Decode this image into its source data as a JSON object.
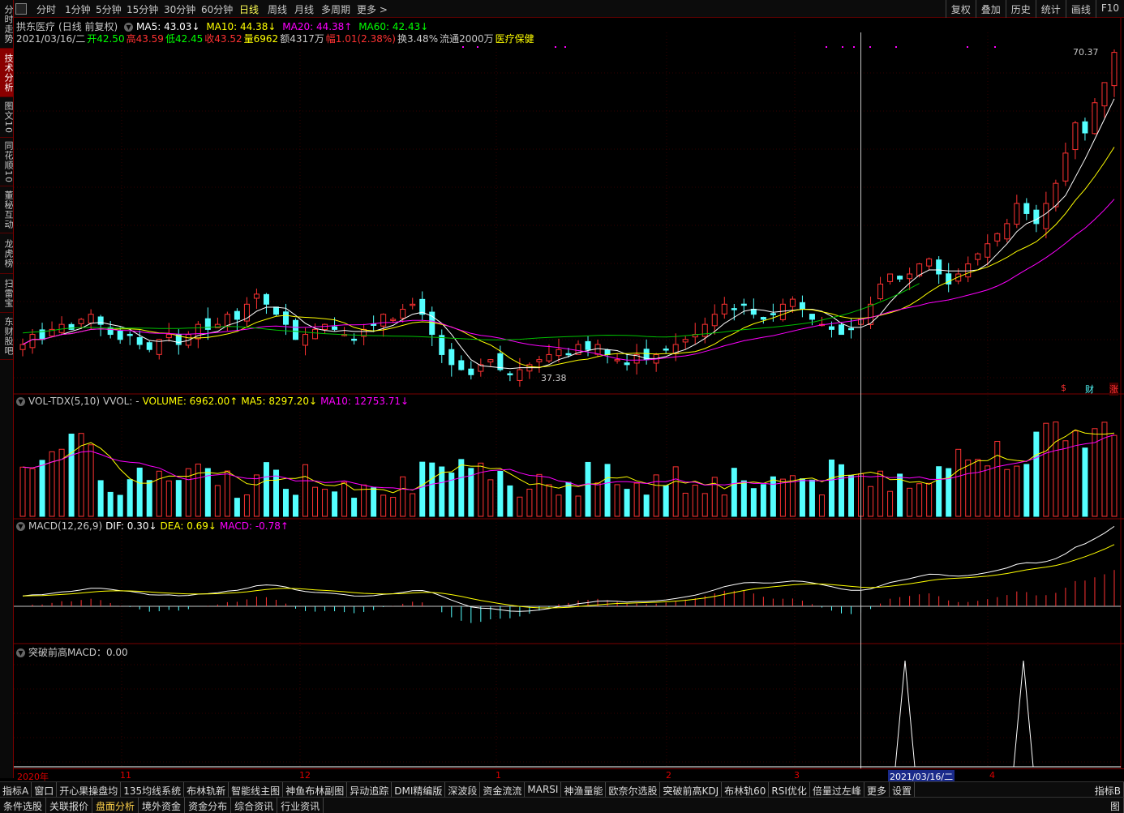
{
  "period_bar": {
    "menu_icon": "menu-icon",
    "items": [
      "分时",
      "1分钟",
      "5分钟",
      "15分钟",
      "30分钟",
      "60分钟",
      "日线",
      "周线",
      "月线",
      "多周期",
      "更多 >"
    ],
    "active": "日线"
  },
  "right_tools": [
    "复权",
    "叠加",
    "历史",
    "统计",
    "画线",
    "F10"
  ],
  "left_tabs": [
    "分时走势",
    "技术分析",
    "图文10",
    "同花顺10",
    "董秘互动",
    "龙虎榜",
    "扫雷宝",
    "东财股吧"
  ],
  "stock": {
    "name": "拱东医疗",
    "mode": "(日线 前复权)",
    "ma5": "MA5: 43.03↓",
    "ma10": "MA10: 44.38↓",
    "ma20": "MA20: 44.38↑",
    "ma60": "MA60: 42.43↓"
  },
  "quote": {
    "date": "2021/03/16/二",
    "open": "开42.50",
    "high": "高43.59",
    "low": "低42.45",
    "close": "收43.52",
    "vol": "量6962",
    "amount": "额4317万",
    "change": "幅1.01(2.38%)",
    "turnover": "换3.48%",
    "float": "流通2000万",
    "sector": "医疗保健"
  },
  "price_marks": {
    "high": "70.37",
    "low": "37.38"
  },
  "side_icons": [
    "$",
    "财",
    "涨"
  ],
  "volume": {
    "label": "VOL-TDX(5,10)",
    "vvol": "VVOL: -",
    "volume": "VOLUME: 6962.00↑",
    "ma5": "MA5: 8297.20↓",
    "ma10": "MA10: 12753.71↓"
  },
  "macd": {
    "label": "MACD(12,26,9)",
    "dif": "DIF: 0.30↓",
    "dea": "DEA: 0.69↓",
    "macd": "MACD: -0.78↑"
  },
  "breakout": {
    "label": "突破前高MACD：0.00"
  },
  "time_axis": {
    "labels": [
      "2020年",
      "11",
      "12",
      "1",
      "2",
      "3",
      "4"
    ],
    "cursor_date": "2021/03/16/二"
  },
  "indicator_tabs": [
    "指标A",
    "窗口",
    "开心果操盘均",
    "135均线系统",
    "布林轨新",
    "智能线主图",
    "神鱼布林副图",
    "异动追踪",
    "DMI精编版",
    "深波段",
    "资金流流",
    "MARSI",
    "神渔量能",
    "欧奈尔选股",
    "突破前高KDJ",
    "布林轨60",
    "RSI优化",
    "倍量过左峰",
    "更多",
    "设置"
  ],
  "indicator_right": "指标B",
  "bottom_tabs": [
    "条件选股",
    "关联报价",
    "盘面分析",
    "境外资金",
    "资金分布",
    "综合资讯",
    "行业资讯"
  ],
  "bottom_right": "图",
  "colors": {
    "up": "#ff3232",
    "down": "#54ffff",
    "ma5": "#ffffff",
    "ma10": "#ffff00",
    "ma20": "#ff00ff",
    "ma60": "#00c000"
  },
  "chart_data": {
    "type": "candlestick",
    "x_start": "2020/10",
    "cursor_index": 86,
    "ohlc_close": [
      41,
      42,
      41.5,
      42.5,
      43,
      42.5,
      43.5,
      44,
      43,
      42,
      41.5,
      42,
      41,
      40.5,
      41.5,
      42,
      41,
      42,
      43,
      42.5,
      43,
      44,
      43.5,
      45,
      46,
      45,
      44,
      43,
      41.5,
      42,
      42.5,
      43,
      42.5,
      42,
      41.5,
      42.5,
      43,
      44,
      43.5,
      44.5,
      45,
      44,
      42,
      40,
      39,
      38.5,
      38,
      39,
      39.5,
      38.5,
      38,
      38.5,
      39,
      39.5,
      40,
      40.5,
      40,
      41,
      40.5,
      41,
      40,
      39.5,
      39,
      40,
      39.5,
      40,
      40.5,
      41,
      41.5,
      42,
      43,
      44,
      45,
      44.5,
      45,
      44,
      43.5,
      44,
      45,
      45.5,
      44.5,
      43.5,
      43,
      42.5,
      42,
      42.5,
      43.5,
      45,
      47,
      48,
      47.5,
      48,
      49,
      49.5,
      48,
      47,
      48,
      49,
      50,
      51,
      52,
      53,
      55,
      54,
      53,
      55,
      57,
      60,
      63,
      62,
      65,
      67,
      70
    ],
    "high": 70.37,
    "low": 37.38
  }
}
